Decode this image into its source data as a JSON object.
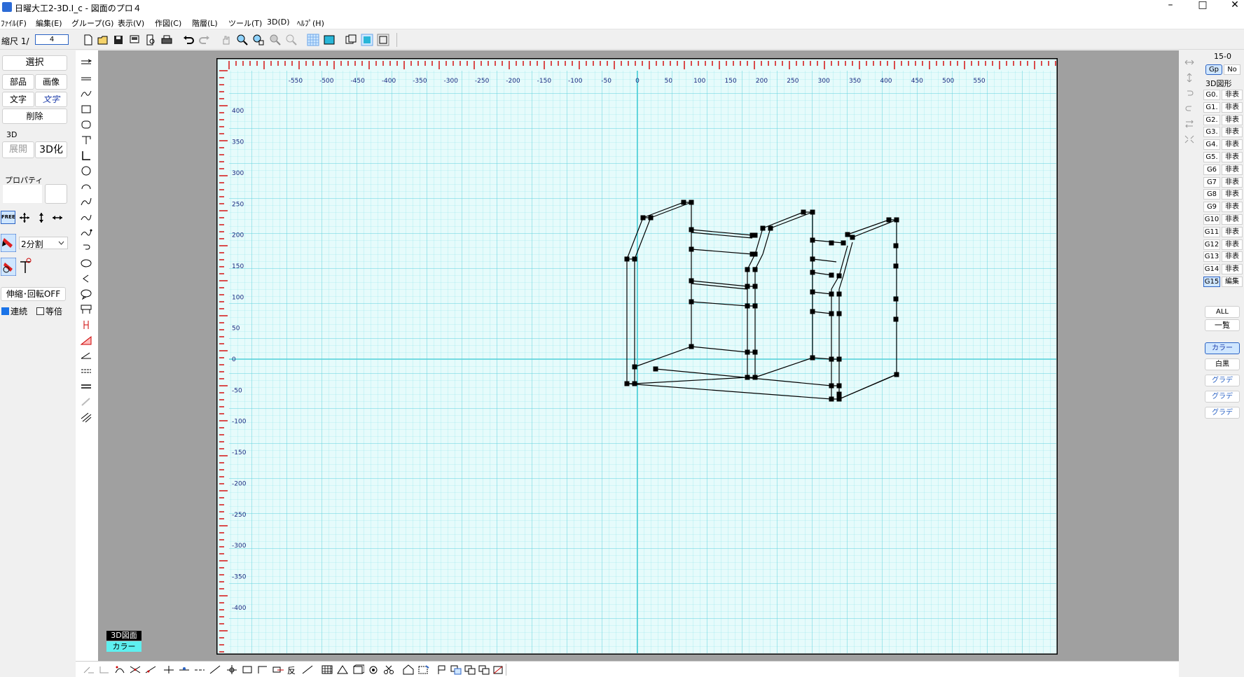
{
  "window": {
    "title": "日曜大工2-3D.I_c - 図面のプロ４",
    "controls": {
      "minimize": "–",
      "maximize": "□",
      "close": "✕"
    }
  },
  "menu": [
    "ﾌｧｲﾙ(F)",
    "編集(E)",
    "グループ(G)",
    "表示(V)",
    "作図(C)",
    "階層(L)",
    "ツール(T)",
    "3D(D)",
    "ﾍﾙﾌﾟ(H)"
  ],
  "toolbar": {
    "scale_label": "縮尺  1/",
    "scale_value": "4"
  },
  "left_panel": {
    "select": "選択",
    "parts": "部品",
    "image": "画像",
    "text": "文字",
    "text_edit": "文字",
    "delete": "削除",
    "section_3d": "3D",
    "expand": "展開",
    "to3d": "3D化",
    "properties": "プロパティ",
    "free": "FREE",
    "divide": "2分割",
    "stretch_toggle": "伸縮･回転OFF",
    "continuous": "連続",
    "equal": "等倍"
  },
  "canvas": {
    "x_ticks": [
      "-550",
      "-500",
      "-450",
      "-400",
      "-350",
      "-300",
      "-250",
      "-200",
      "-150",
      "-100",
      "-50",
      "0",
      "50",
      "100",
      "150",
      "200",
      "250",
      "300",
      "350",
      "400",
      "450",
      "500",
      "550"
    ],
    "y_ticks": [
      "400",
      "350",
      "300",
      "250",
      "200",
      "150",
      "100",
      "50",
      "0",
      "-50",
      "-100",
      "-150",
      "-200",
      "-250",
      "-300",
      "-350",
      "-400"
    ],
    "grid_color": "#7ee0e8",
    "paper_color": "#e6fbfb",
    "ruler_color": "#d40000",
    "badge_top": "3D図面",
    "badge_bottom": "カラー"
  },
  "right_panel": {
    "layer": "15-0",
    "gp": "Gp",
    "no": "No",
    "section": "3D図形",
    "groups": [
      {
        "name": "G0.",
        "state": "非表"
      },
      {
        "name": "G1.",
        "state": "非表"
      },
      {
        "name": "G2.",
        "state": "非表"
      },
      {
        "name": "G3.",
        "state": "非表"
      },
      {
        "name": "G4.",
        "state": "非表"
      },
      {
        "name": "G5.",
        "state": "非表"
      },
      {
        "name": "G6",
        "state": "非表"
      },
      {
        "name": "G7",
        "state": "非表"
      },
      {
        "name": "G8",
        "state": "非表"
      },
      {
        "name": "G9",
        "state": "非表"
      },
      {
        "name": "G10",
        "state": "非表"
      },
      {
        "name": "G11",
        "state": "非表"
      },
      {
        "name": "G12",
        "state": "非表"
      },
      {
        "name": "G13",
        "state": "非表"
      },
      {
        "name": "G14",
        "state": "非表"
      },
      {
        "name": "G15",
        "state": "編集"
      }
    ],
    "all": "ALL",
    "list": "一覧",
    "color": "カラー",
    "mono": "白黒",
    "grad1": "グラデ",
    "grad2": "グラデ",
    "grad3": "グラデ"
  }
}
